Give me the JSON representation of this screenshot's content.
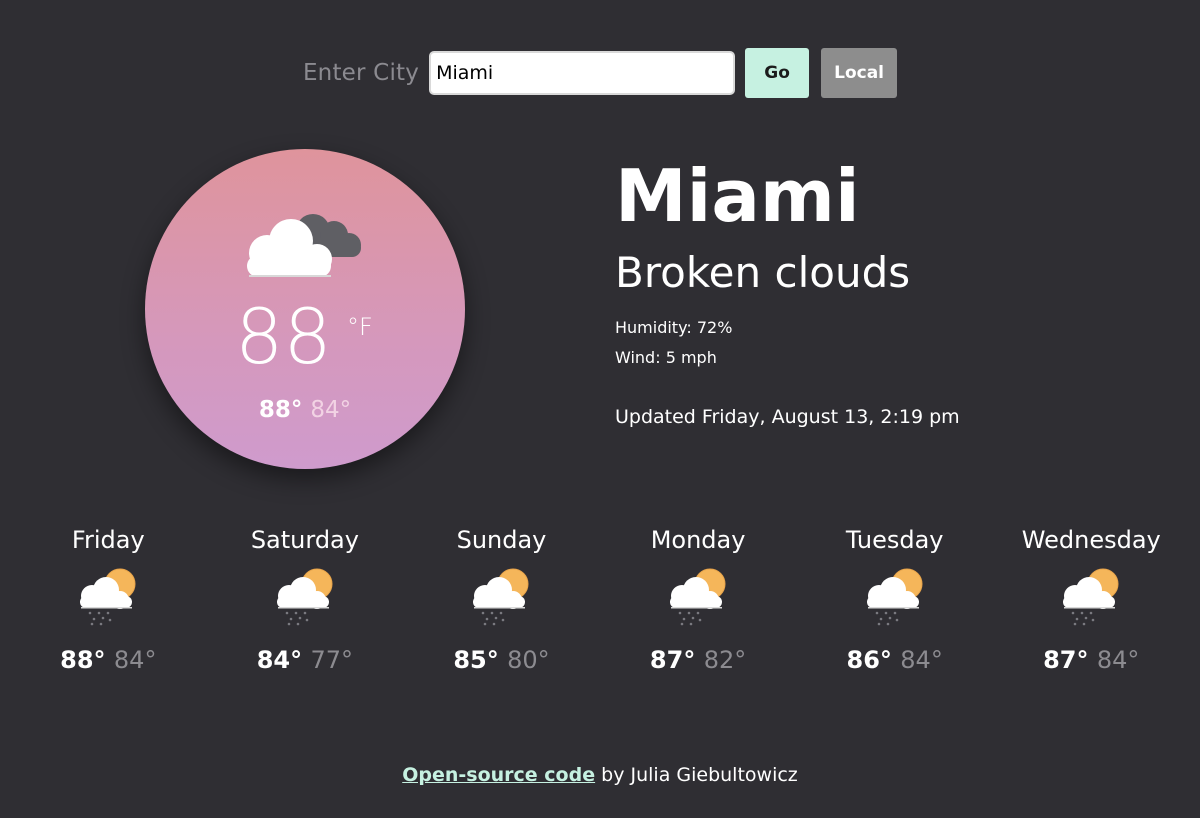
{
  "search": {
    "label": "Enter City",
    "value": "Miami",
    "go_label": "Go",
    "local_label": "Local"
  },
  "current": {
    "icon": "broken-clouds-icon",
    "temperature": "88",
    "unit": "°F",
    "high": "88°",
    "low": "84°",
    "city": "Miami",
    "description": "Broken clouds",
    "humidity": "Humidity: 72%",
    "wind": "Wind: 5 mph",
    "updated": "Updated Friday, August 13, 2:19 pm"
  },
  "forecast": [
    {
      "day": "Friday",
      "icon": "rain-partly-sunny-icon",
      "high": "88°",
      "low": "84°"
    },
    {
      "day": "Saturday",
      "icon": "rain-partly-sunny-icon",
      "high": "84°",
      "low": "77°"
    },
    {
      "day": "Sunday",
      "icon": "rain-partly-sunny-icon",
      "high": "85°",
      "low": "80°"
    },
    {
      "day": "Monday",
      "icon": "rain-partly-sunny-icon",
      "high": "87°",
      "low": "82°"
    },
    {
      "day": "Tuesday",
      "icon": "rain-partly-sunny-icon",
      "high": "86°",
      "low": "84°"
    },
    {
      "day": "Wednesday",
      "icon": "rain-partly-sunny-icon",
      "high": "87°",
      "low": "84°"
    }
  ],
  "footer": {
    "link_text": "Open-source code",
    "suffix": " by Julia Giebultowicz"
  },
  "colors": {
    "background": "#2f2e33",
    "accent": "#c6f1e1",
    "muted": "#8c8b90"
  }
}
